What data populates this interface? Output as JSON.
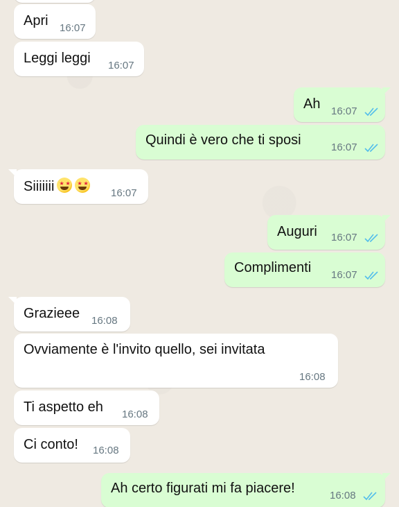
{
  "colors": {
    "background": "#efeae2",
    "incoming_bubble": "#ffffff",
    "outgoing_bubble": "#d9fdd3",
    "timestamp": "#667781",
    "read_ticks": "#53bdeb"
  },
  "messages": [
    {
      "direction": "incoming",
      "text": "Apri",
      "time": "16:07"
    },
    {
      "direction": "incoming",
      "text": "Leggi leggi",
      "time": "16:07"
    },
    {
      "direction": "outgoing",
      "text": "Ah",
      "time": "16:07",
      "status_icon": "double-check-read-icon"
    },
    {
      "direction": "outgoing",
      "text": "Quindi è vero che ti sposi",
      "time": "16:07",
      "status_icon": "double-check-read-icon"
    },
    {
      "direction": "incoming",
      "text": "Siiiiiii",
      "emojis": [
        "star-struck-emoji",
        "star-struck-emoji"
      ],
      "time": "16:07"
    },
    {
      "direction": "outgoing",
      "text": "Auguri",
      "time": "16:07",
      "status_icon": "double-check-read-icon"
    },
    {
      "direction": "outgoing",
      "text": "Complimenti",
      "time": "16:07",
      "status_icon": "double-check-read-icon"
    },
    {
      "direction": "incoming",
      "text": "Grazieee",
      "time": "16:08"
    },
    {
      "direction": "incoming",
      "text": "Ovviamente è l'invito quello, sei invitata",
      "time": "16:08"
    },
    {
      "direction": "incoming",
      "text": "Ti aspetto eh",
      "time": "16:08"
    },
    {
      "direction": "incoming",
      "text": "Ci conto!",
      "time": "16:08"
    },
    {
      "direction": "outgoing",
      "text": "Ah certo figurati mi fa piacere!",
      "time": "16:08",
      "status_icon": "double-check-read-icon"
    }
  ]
}
